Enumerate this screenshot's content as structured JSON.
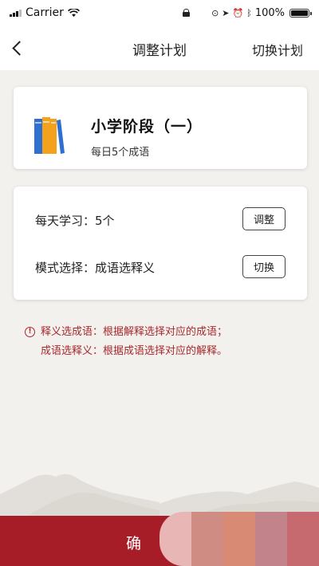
{
  "status_bar": {
    "carrier": "Carrier",
    "battery_text": "100%",
    "battery_level": 1.0
  },
  "nav": {
    "title": "调整计划",
    "right_action": "切换计划"
  },
  "plan": {
    "name": "小学阶段（一）",
    "subtitle": "每日5个成语"
  },
  "settings": {
    "daily_label": "每天学习：5个",
    "adjust_button": "调整",
    "mode_label": "模式选择：成语选释义",
    "switch_button": "切换"
  },
  "notes": {
    "line1": "释义选成语：根据解释选择对应的成语；",
    "line2": "成语选释义：根据成语选择对应的解释。"
  },
  "confirm": {
    "visible_text": "确"
  },
  "colors": {
    "accent": "#a71d27",
    "note_text": "#a8282c",
    "background": "#f3f1ee"
  },
  "icons": [
    "signal-icon",
    "wifi-icon",
    "lock-icon",
    "location-icon",
    "alarm-icon",
    "bluetooth-icon",
    "battery-icon",
    "back-icon",
    "books-icon",
    "info-icon"
  ]
}
